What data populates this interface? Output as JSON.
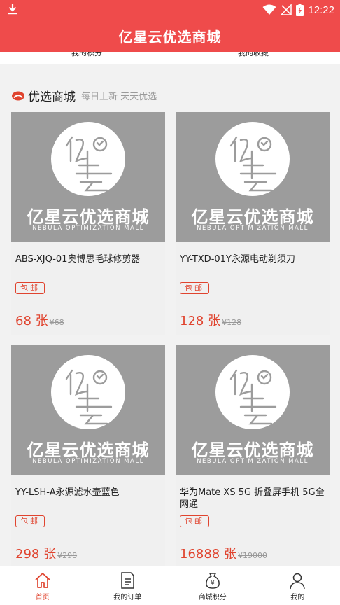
{
  "status_bar": {
    "time": "12:22"
  },
  "header": {
    "title": "亿星云优选商城"
  },
  "top_tabs": {
    "left": "我的积分",
    "right": "我的收藏"
  },
  "section": {
    "title": "优选商城",
    "subtitle": "每日上新 天天优选"
  },
  "placeholder_image": {
    "brand_cn": "亿星云优选商城",
    "brand_en": "NEBULA OPTIMIZATION MALL"
  },
  "products": [
    {
      "name": "ABS-XJQ-01奥博思毛球修剪器",
      "tag": "包邮",
      "price": "68 张",
      "old_price": "¥68"
    },
    {
      "name": "YY-TXD-01Y永源电动剃须刀",
      "tag": "包邮",
      "price": "128 张",
      "old_price": "¥128"
    },
    {
      "name": "YY-LSH-A永源滤水壶蓝色",
      "tag": "包邮",
      "price": "298 张",
      "old_price": "¥298"
    },
    {
      "name": "华为Mate XS 5G 折叠屏手机 5G全网通",
      "tag": "包邮",
      "price": "16888 张",
      "old_price": "¥19000"
    }
  ],
  "bottom_nav": [
    {
      "label": "首页",
      "icon": "home-icon",
      "active": true
    },
    {
      "label": "我的订单",
      "icon": "order-icon",
      "active": false
    },
    {
      "label": "商城积分",
      "icon": "points-bag-icon",
      "active": false
    },
    {
      "label": "我的",
      "icon": "user-icon",
      "active": false
    }
  ],
  "colors": {
    "primary": "#ef4b4b",
    "price": "#e0442f",
    "placeholder_bg": "#9c9c9c"
  }
}
